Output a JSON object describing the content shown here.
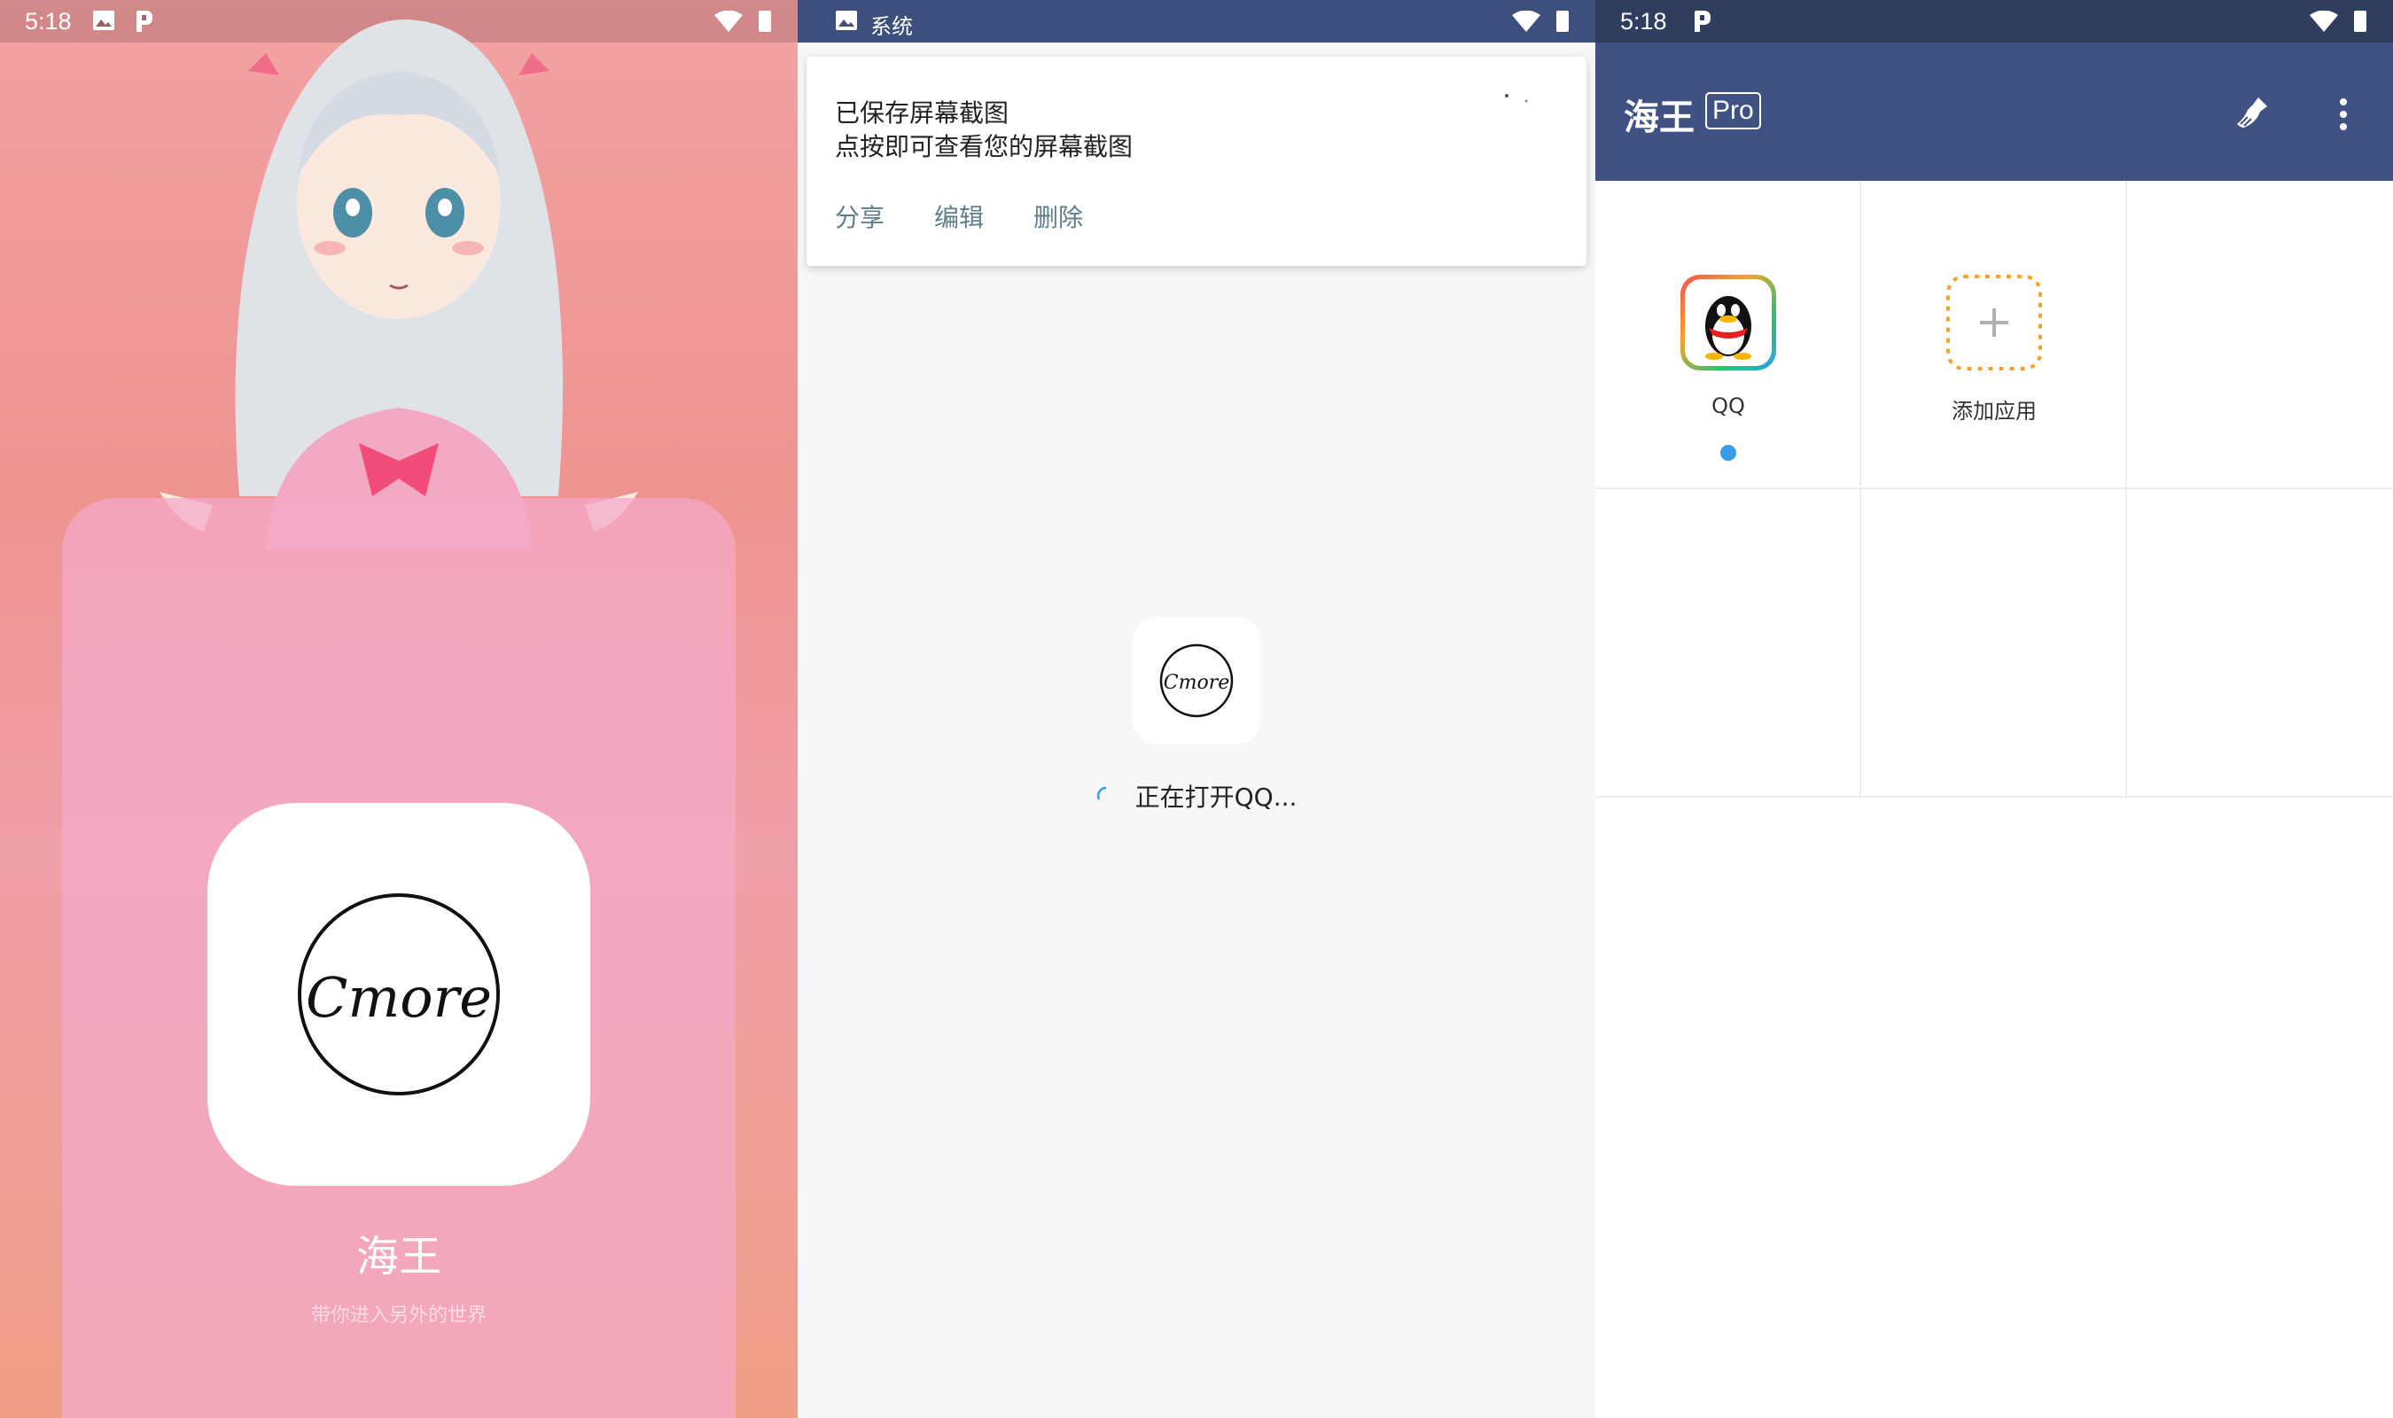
{
  "panel1": {
    "status": {
      "time": "5:18"
    },
    "app_name": "海王",
    "slogan": "带你进入另外的世界",
    "logo_text": "Cmore"
  },
  "panel2": {
    "status": {
      "label": "系统"
    },
    "notification": {
      "line1": "已保存屏幕截图",
      "line2": "点按即可查看您的屏幕截图",
      "actions": [
        "分享",
        "编辑",
        "删除"
      ]
    },
    "logo_text": "Cmore",
    "loading_text": "正在打开QQ..."
  },
  "panel3": {
    "status": {
      "time": "5:18"
    },
    "appbar": {
      "title": "海王",
      "badge": "Pro"
    },
    "apps": [
      {
        "label": "QQ",
        "icon": "qq-penguin-icon",
        "running": true
      },
      {
        "label": "添加应用",
        "icon": "add-app-icon"
      }
    ]
  },
  "colors": {
    "appbar": "#3f5283",
    "status_dark": "#2f3d5e",
    "accent_blue": "#3a9be6",
    "action_gray": "#607d8b"
  }
}
